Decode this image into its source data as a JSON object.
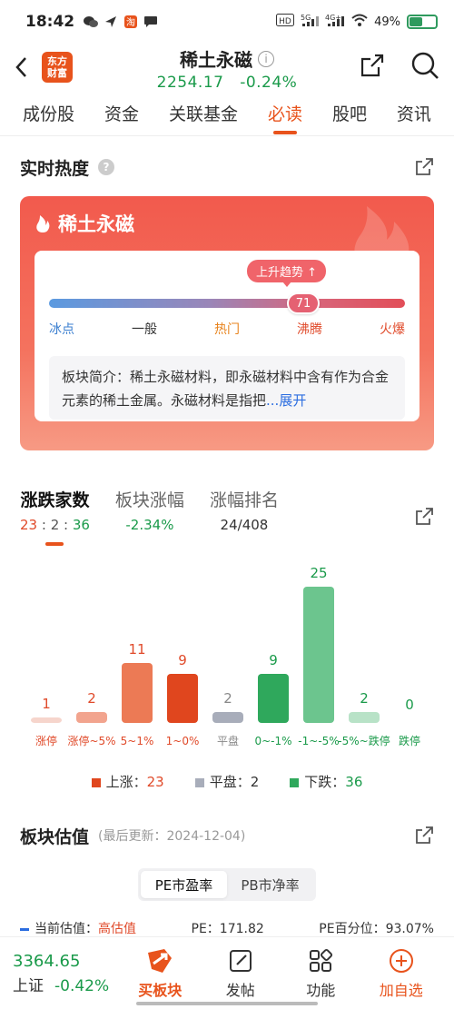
{
  "status": {
    "time": "18:42",
    "battery": "49%",
    "battery_level": 0.49
  },
  "header": {
    "logo_top": "东方",
    "logo_bottom": "财富",
    "title": "稀土永磁",
    "price": "2254.17",
    "change": "-0.24%"
  },
  "tabs": [
    "成份股",
    "资金",
    "关联基金",
    "必读",
    "股吧",
    "资讯"
  ],
  "active_tab": "必读",
  "heat": {
    "section_title": "实时热度",
    "card_title": "稀土永磁",
    "trend_label": "上升趋势",
    "score": "71",
    "levels": [
      "冰点",
      "一般",
      "热门",
      "沸腾",
      "火爆"
    ],
    "level_colors": [
      "#3b7fd0",
      "#333333",
      "#e8831c",
      "#e04a2a",
      "#e04a2a"
    ],
    "intro_label": "板块简介：",
    "intro_text": "稀土永磁材料，即永磁材料中含有作为合金元素的稀土金属。永磁材料是指把",
    "intro_more": "...展开"
  },
  "updown": {
    "tabs": [
      {
        "label": "涨跌家数",
        "up": "23",
        "flat": "2",
        "down": "36"
      },
      {
        "label": "板块涨幅",
        "value": "-2.34%"
      },
      {
        "label": "涨幅排名",
        "value": "24/408"
      }
    ],
    "legend": {
      "up_label": "上涨：",
      "up": "23",
      "flat_label": "平盘：",
      "flat": "2",
      "down_label": "下跌：",
      "down": "36"
    }
  },
  "chart_data": {
    "type": "bar",
    "categories": [
      "涨停",
      "涨停~5%",
      "5~1%",
      "1~0%",
      "平盘",
      "0~-1%",
      "-1~-5%",
      "-5%~跌停",
      "跌停"
    ],
    "values": [
      1,
      2,
      11,
      9,
      2,
      9,
      25,
      2,
      0
    ],
    "colors": [
      "#f6d5cc",
      "#f2a48e",
      "#ec7a55",
      "#e0461e",
      "#a8adba",
      "#2fa85c",
      "#6cc58e",
      "#b8e2c7",
      "#6cc58e"
    ],
    "label_colors": [
      "#e04a2a",
      "#e04a2a",
      "#e04a2a",
      "#e04a2a",
      "#888888",
      "#1a9a4a",
      "#1a9a4a",
      "#1a9a4a",
      "#1a9a4a"
    ],
    "ylim": [
      0,
      25
    ]
  },
  "valuation": {
    "title": "板块估值",
    "updated": "(最后更新：2024-12-04)",
    "options": [
      "PE市盈率",
      "PB市净率"
    ],
    "current_label": "当前估值：",
    "current": "高估值",
    "pe_label": "PE：",
    "pe": "171.82",
    "pct_label": "PE百分位：",
    "pct": "93.07%"
  },
  "bottom": {
    "index_value": "3364.65",
    "index_name": "上证",
    "index_change": "-0.42%",
    "nav": [
      "买板块",
      "发帖",
      "功能",
      "加自选"
    ]
  }
}
